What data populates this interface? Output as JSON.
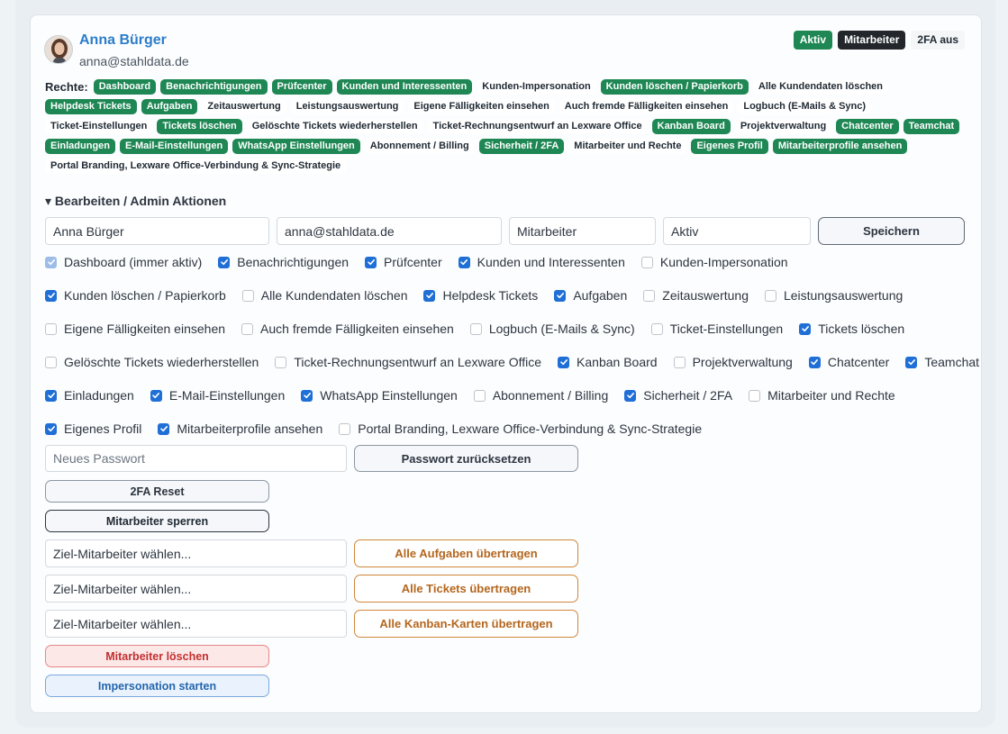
{
  "user": {
    "name": "Anna Bürger",
    "email": "anna@stahldata.de",
    "badges": [
      "Aktiv",
      "Mitarbeiter",
      "2FA aus"
    ]
  },
  "rights": {
    "label": "Rechte:",
    "items": [
      {
        "label": "Dashboard",
        "on": true
      },
      {
        "label": "Benachrichtigungen",
        "on": true
      },
      {
        "label": "Prüfcenter",
        "on": true
      },
      {
        "label": "Kunden und Interessenten",
        "on": true
      },
      {
        "label": "Kunden-Impersonation",
        "on": false
      },
      {
        "label": "Kunden löschen / Papierkorb",
        "on": true
      },
      {
        "label": "Alle Kundendaten löschen",
        "on": false
      },
      {
        "label": "Helpdesk Tickets",
        "on": true
      },
      {
        "label": "Aufgaben",
        "on": true
      },
      {
        "label": "Zeitauswertung",
        "on": false
      },
      {
        "label": "Leistungsauswertung",
        "on": false
      },
      {
        "label": "Eigene Fälligkeiten einsehen",
        "on": false
      },
      {
        "label": "Auch fremde Fälligkeiten einsehen",
        "on": false
      },
      {
        "label": "Logbuch (E-Mails & Sync)",
        "on": false
      },
      {
        "label": "Ticket-Einstellungen",
        "on": false
      },
      {
        "label": "Tickets löschen",
        "on": true
      },
      {
        "label": "Gelöschte Tickets wiederherstellen",
        "on": false
      },
      {
        "label": "Ticket-Rechnungsentwurf an Lexware Office",
        "on": false
      },
      {
        "label": "Kanban Board",
        "on": true
      },
      {
        "label": "Projektverwaltung",
        "on": false
      },
      {
        "label": "Chatcenter",
        "on": true
      },
      {
        "label": "Teamchat",
        "on": true
      },
      {
        "label": "Einladungen",
        "on": true
      },
      {
        "label": "E-Mail-Einstellungen",
        "on": true
      },
      {
        "label": "WhatsApp Einstellungen",
        "on": true
      },
      {
        "label": "Abonnement / Billing",
        "on": false
      },
      {
        "label": "Sicherheit / 2FA",
        "on": true
      },
      {
        "label": "Mitarbeiter und Rechte",
        "on": false
      },
      {
        "label": "Eigenes Profil",
        "on": true
      },
      {
        "label": "Mitarbeiterprofile ansehen",
        "on": true
      },
      {
        "label": "Portal Branding, Lexware Office-Verbindung & Sync-Strategie",
        "on": false
      }
    ]
  },
  "admin": {
    "toggle_label": "▾ Bearbeiten / Admin Aktionen",
    "name_value": "Anna Bürger",
    "email_value": "anna@stahldata.de",
    "role_value": "Mitarbeiter",
    "status_value": "Aktiv",
    "save_label": "Speichern",
    "permission_rows": [
      [
        {
          "label": "Dashboard (immer aktiv)",
          "checked": true,
          "disabled": true
        },
        {
          "label": "Benachrichtigungen",
          "checked": true
        },
        {
          "label": "Prüfcenter",
          "checked": true
        },
        {
          "label": "Kunden und Interessenten",
          "checked": true
        },
        {
          "label": "Kunden-Impersonation",
          "checked": false
        }
      ],
      [
        {
          "label": "Kunden löschen / Papierkorb",
          "checked": true
        },
        {
          "label": "Alle Kundendaten löschen",
          "checked": false
        },
        {
          "label": "Helpdesk Tickets",
          "checked": true
        },
        {
          "label": "Aufgaben",
          "checked": true
        },
        {
          "label": "Zeitauswertung",
          "checked": false
        },
        {
          "label": "Leistungsauswertung",
          "checked": false
        }
      ],
      [
        {
          "label": "Eigene Fälligkeiten einsehen",
          "checked": false
        },
        {
          "label": "Auch fremde Fälligkeiten einsehen",
          "checked": false
        },
        {
          "label": "Logbuch (E-Mails & Sync)",
          "checked": false
        },
        {
          "label": "Ticket-Einstellungen",
          "checked": false
        },
        {
          "label": "Tickets löschen",
          "checked": true
        }
      ],
      [
        {
          "label": "Gelöschte Tickets wiederherstellen",
          "checked": false
        },
        {
          "label": "Ticket-Rechnungsentwurf an Lexware Office",
          "checked": false
        },
        {
          "label": "Kanban Board",
          "checked": true
        },
        {
          "label": "Projektverwaltung",
          "checked": false
        },
        {
          "label": "Chatcenter",
          "checked": true
        },
        {
          "label": "Teamchat",
          "checked": true
        }
      ],
      [
        {
          "label": "Einladungen",
          "checked": true
        },
        {
          "label": "E-Mail-Einstellungen",
          "checked": true
        },
        {
          "label": "WhatsApp Einstellungen",
          "checked": true
        },
        {
          "label": "Abonnement / Billing",
          "checked": false
        },
        {
          "label": "Sicherheit / 2FA",
          "checked": true
        },
        {
          "label": "Mitarbeiter und Rechte",
          "checked": false
        }
      ],
      [
        {
          "label": "Eigenes Profil",
          "checked": true
        },
        {
          "label": "Mitarbeiterprofile ansehen",
          "checked": true
        },
        {
          "label": "Portal Branding, Lexware Office-Verbindung & Sync-Strategie",
          "checked": false
        }
      ]
    ],
    "password_placeholder": "Neues Passwort",
    "password_reset_label": "Passwort zurücksetzen",
    "twofa_reset_label": "2FA Reset",
    "lock_label": "Mitarbeiter sperren",
    "target_placeholder": "Ziel-Mitarbeiter wählen...",
    "transfer_tasks_label": "Alle Aufgaben übertragen",
    "transfer_tickets_label": "Alle Tickets übertragen",
    "transfer_kanban_label": "Alle Kanban-Karten übertragen",
    "delete_label": "Mitarbeiter löschen",
    "impersonate_label": "Impersonation starten"
  },
  "colors": {
    "accent_green": "#1e8754",
    "link_blue": "#2b7cc9",
    "checkbox_blue": "#1f6fd6",
    "danger_red": "#c23030",
    "warning_orange": "#b4661d"
  }
}
